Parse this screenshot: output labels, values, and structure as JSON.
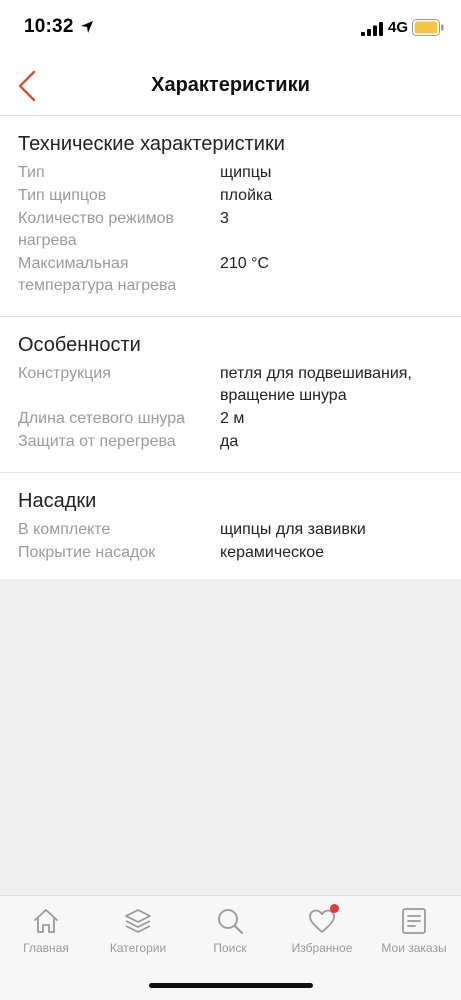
{
  "status_bar": {
    "time": "10:32",
    "network": "4G"
  },
  "nav": {
    "title": "Характеристики"
  },
  "sections": [
    {
      "title": "Технические характеристики",
      "rows": [
        {
          "label": "Тип",
          "value": "щипцы"
        },
        {
          "label": "Тип щипцов",
          "value": "плойка"
        },
        {
          "label": "Количество режимов нагрева",
          "value": "3"
        },
        {
          "label": "Максимальная температура нагрева",
          "value": "210 °C"
        }
      ]
    },
    {
      "title": "Особенности",
      "rows": [
        {
          "label": "Конструкция",
          "value": "петля для подвешивания, вращение шнура"
        },
        {
          "label": "Длина сетевого шнура",
          "value": "2 м"
        },
        {
          "label": "Защита от перегрева",
          "value": "да"
        }
      ]
    },
    {
      "title": "Насадки",
      "rows": [
        {
          "label": "В комплекте",
          "value": "щипцы для завивки"
        },
        {
          "label": "Покрытие насадок",
          "value": "керамическое"
        }
      ]
    }
  ],
  "tab_bar": {
    "items": [
      {
        "label": "Главная",
        "icon": "home-icon"
      },
      {
        "label": "Категории",
        "icon": "layers-icon"
      },
      {
        "label": "Поиск",
        "icon": "search-icon"
      },
      {
        "label": "Избранное",
        "icon": "heart-icon"
      },
      {
        "label": "Мои заказы",
        "icon": "orders-icon"
      }
    ]
  },
  "colors": {
    "accent": "#d4582f",
    "badge": "#e53935",
    "label_gray": "#9b9b9b",
    "battery": "#f4c542"
  }
}
